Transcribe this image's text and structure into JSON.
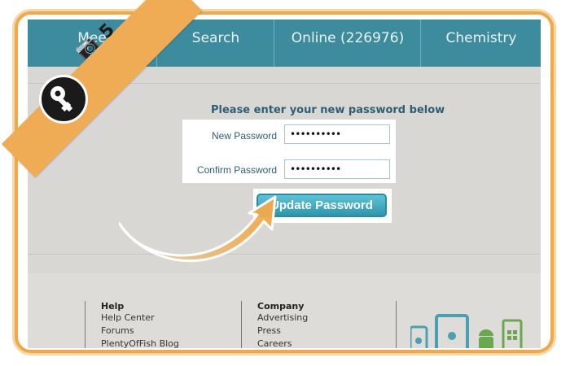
{
  "nav": {
    "tabs": [
      "Mee",
      "Search",
      "Online (226976)",
      "Chemistry"
    ]
  },
  "form": {
    "prompt": "Please enter your new password below",
    "new_password_label": "New Password",
    "new_password_value": "••••••••••",
    "confirm_password_label": "Confirm Password",
    "confirm_password_value": "••••••••••",
    "submit_label": "Update Password"
  },
  "footer": {
    "help": {
      "heading": "Help",
      "links": [
        "Help Center",
        "Forums",
        "PlentyOfFish Blog"
      ]
    },
    "company": {
      "heading": "Company",
      "links": [
        "Advertising",
        "Press",
        "Careers"
      ]
    }
  },
  "overlay": {
    "step_number": "5",
    "icons": [
      "key-icon",
      "camera-icon",
      "curved-arrow-icon"
    ]
  },
  "colors": {
    "nav": "#3d8c9e",
    "accent_orange": "#f0ac55",
    "button": "#3aa6bd"
  }
}
